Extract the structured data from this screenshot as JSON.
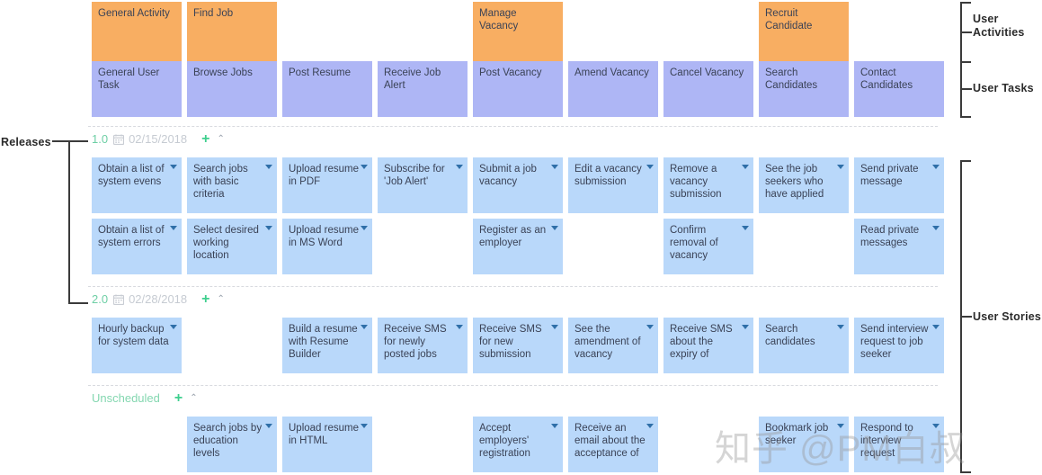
{
  "board": {
    "column_count": 9,
    "colors": {
      "activity": "#f8ae62",
      "task": "#aeb6f5",
      "story": "#b9d8fa",
      "release_green": "#6ecfa5",
      "date_gray": "#c6cbd2",
      "plus_green": "#3ecf8e"
    }
  },
  "labels": {
    "releases": "Releases",
    "user_activities": "User\nActivities",
    "user_activities_line1": "User",
    "user_activities_line2": "Activities",
    "user_tasks": "User Tasks",
    "user_stories": "User Stories"
  },
  "activities": [
    {
      "col": 0,
      "label": "General Activity"
    },
    {
      "col": 1,
      "label": "Find Job"
    },
    {
      "col": 4,
      "label": "Manage Vacancy"
    },
    {
      "col": 7,
      "label": "Recruit Candidate"
    }
  ],
  "tasks": [
    {
      "col": 0,
      "label": "General User Task"
    },
    {
      "col": 1,
      "label": "Browse Jobs"
    },
    {
      "col": 2,
      "label": "Post Resume"
    },
    {
      "col": 3,
      "label": "Receive Job Alert"
    },
    {
      "col": 4,
      "label": "Post Vacancy"
    },
    {
      "col": 5,
      "label": "Amend Vacancy"
    },
    {
      "col": 6,
      "label": "Cancel Vacancy"
    },
    {
      "col": 7,
      "label": "Search Candidates"
    },
    {
      "col": 8,
      "label": "Contact Candidates"
    }
  ],
  "releases": [
    {
      "id": "release-1",
      "version": "1.0",
      "date": "02/15/2018",
      "calendar_icon": "calendar-icon",
      "add_icon": "plus-icon",
      "collapse_icon": "chevron-up-icon",
      "rows": [
        [
          {
            "col": 0,
            "label": "Obtain a list of system evens"
          },
          {
            "col": 1,
            "label": "Search jobs with basic criteria"
          },
          {
            "col": 2,
            "label": "Upload resume in PDF"
          },
          {
            "col": 3,
            "label": "Subscribe for 'Job Alert'"
          },
          {
            "col": 4,
            "label": "Submit a job vacancy"
          },
          {
            "col": 5,
            "label": "Edit a vacancy submission"
          },
          {
            "col": 6,
            "label": "Remove a vacancy submission"
          },
          {
            "col": 7,
            "label": "See the job seekers who have applied"
          },
          {
            "col": 8,
            "label": "Send private message"
          }
        ],
        [
          {
            "col": 0,
            "label": "Obtain a list of system errors"
          },
          {
            "col": 1,
            "label": "Select desired working location"
          },
          {
            "col": 2,
            "label": "Upload resume in MS Word"
          },
          {
            "col": 4,
            "label": "Register as an employer"
          },
          {
            "col": 6,
            "label": "Confirm removal of vacancy"
          },
          {
            "col": 8,
            "label": "Read private messages"
          }
        ]
      ]
    },
    {
      "id": "release-2",
      "version": "2.0",
      "date": "02/28/2018",
      "calendar_icon": "calendar-icon",
      "add_icon": "plus-icon",
      "collapse_icon": "chevron-up-icon",
      "rows": [
        [
          {
            "col": 0,
            "label": "Hourly backup for system data"
          },
          {
            "col": 2,
            "label": "Build a resume with Resume Builder"
          },
          {
            "col": 3,
            "label": "Receive SMS for newly posted jobs"
          },
          {
            "col": 4,
            "label": "Receive SMS for new submission"
          },
          {
            "col": 5,
            "label": "See the amendment of vacancy"
          },
          {
            "col": 6,
            "label": "Receive SMS about the expiry of"
          },
          {
            "col": 7,
            "label": "Search candidates"
          },
          {
            "col": 8,
            "label": "Send interview request to job seeker"
          }
        ]
      ]
    },
    {
      "id": "release-unscheduled",
      "version": "Unscheduled",
      "date": "",
      "calendar_icon": "",
      "add_icon": "plus-icon",
      "collapse_icon": "chevron-up-icon",
      "rows": [
        [
          {
            "col": 1,
            "label": "Search jobs by education levels"
          },
          {
            "col": 2,
            "label": "Upload resume in HTML"
          },
          {
            "col": 4,
            "label": "Accept employers' registration"
          },
          {
            "col": 5,
            "label": "Receive an email about the acceptance of"
          },
          {
            "col": 7,
            "label": "Bookmark job seeker"
          },
          {
            "col": 8,
            "label": "Respond to interview request"
          }
        ]
      ]
    }
  ],
  "watermark": {
    "text": "知乎 @PM白叔"
  }
}
